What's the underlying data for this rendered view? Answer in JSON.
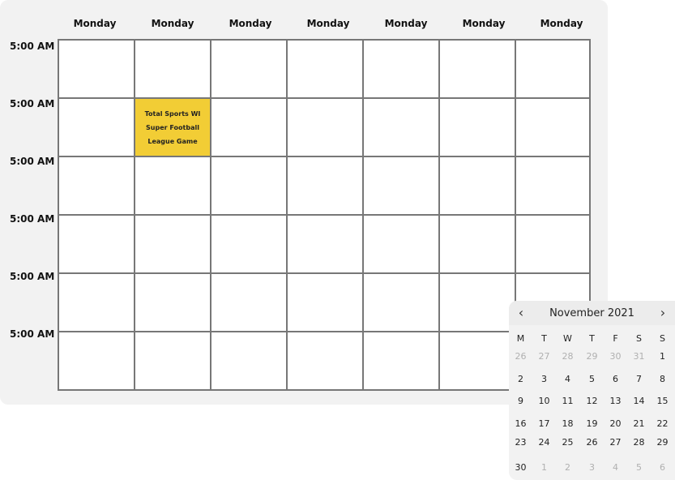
{
  "week_view": {
    "day_headers": [
      "Monday",
      "Monday",
      "Monday",
      "Monday",
      "Monday",
      "Monday",
      "Monday"
    ],
    "time_slots": [
      "5:00 AM",
      "5:00 AM",
      "5:00 AM",
      "5:00 AM",
      "5:00 AM",
      "5:00 AM"
    ],
    "event": {
      "title": "Total Sports WI\nSuper Football\nLeague Game",
      "day_index": 1,
      "slot_index": 1,
      "color": "#f2cd35"
    }
  },
  "datepicker": {
    "title": "November 2021",
    "prev_icon": "chevron-left-icon",
    "next_icon": "chevron-right-icon",
    "weekdays": [
      "M",
      "T",
      "W",
      "T",
      "F",
      "S",
      "S"
    ],
    "weeks": [
      [
        {
          "d": "26",
          "m": true
        },
        {
          "d": "27",
          "m": true
        },
        {
          "d": "28",
          "m": true
        },
        {
          "d": "29",
          "m": true
        },
        {
          "d": "30",
          "m": true
        },
        {
          "d": "31",
          "m": true
        },
        {
          "d": "1",
          "m": false
        }
      ],
      [
        {
          "d": "2",
          "m": false
        },
        {
          "d": "3",
          "m": false
        },
        {
          "d": "4",
          "m": false
        },
        {
          "d": "5",
          "m": false
        },
        {
          "d": "6",
          "m": false
        },
        {
          "d": "7",
          "m": false
        },
        {
          "d": "8",
          "m": false
        }
      ],
      [
        {
          "d": "9",
          "m": false
        },
        {
          "d": "10",
          "m": false
        },
        {
          "d": "11",
          "m": false
        },
        {
          "d": "12",
          "m": false
        },
        {
          "d": "13",
          "m": false
        },
        {
          "d": "14",
          "m": false
        },
        {
          "d": "15",
          "m": false
        }
      ],
      [
        {
          "d": "16",
          "m": false
        },
        {
          "d": "17",
          "m": false
        },
        {
          "d": "18",
          "m": false
        },
        {
          "d": "19",
          "m": false
        },
        {
          "d": "20",
          "m": false
        },
        {
          "d": "21",
          "m": false
        },
        {
          "d": "22",
          "m": false
        }
      ],
      [
        {
          "d": "23",
          "m": false
        },
        {
          "d": "24",
          "m": false
        },
        {
          "d": "25",
          "m": false
        },
        {
          "d": "26",
          "m": false
        },
        {
          "d": "27",
          "m": false
        },
        {
          "d": "28",
          "m": false
        },
        {
          "d": "29",
          "m": false
        }
      ],
      [
        {
          "d": "30",
          "m": false
        },
        {
          "d": "1",
          "m": true
        },
        {
          "d": "2",
          "m": true
        },
        {
          "d": "3",
          "m": true
        },
        {
          "d": "4",
          "m": true
        },
        {
          "d": "5",
          "m": true
        },
        {
          "d": "6",
          "m": true
        }
      ]
    ],
    "colors": {
      "muted": "#b0b0b0",
      "text": "#222222"
    }
  }
}
